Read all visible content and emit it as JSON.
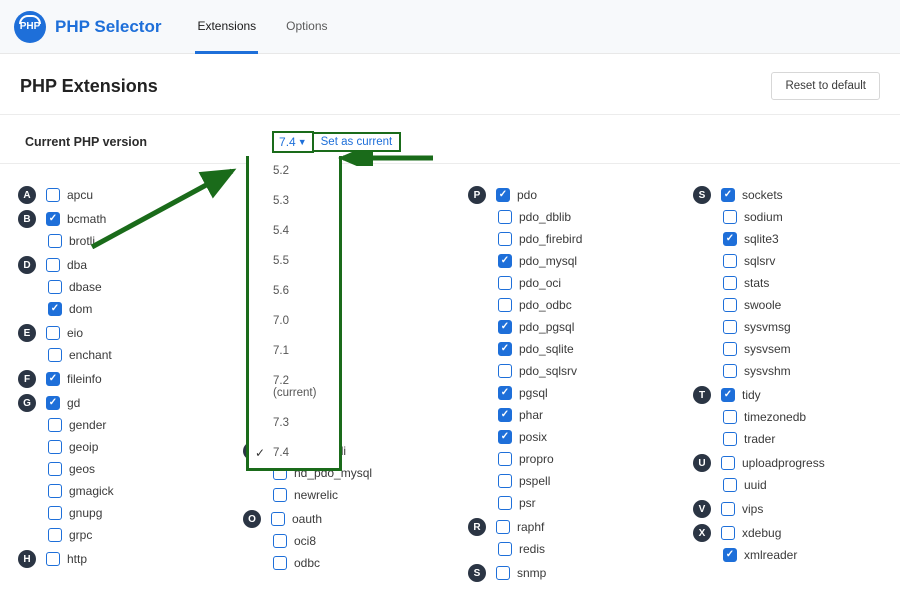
{
  "header": {
    "logo_text": "PHP",
    "app_title": "PHP Selector",
    "tabs": [
      {
        "label": "Extensions",
        "active": true
      },
      {
        "label": "Options",
        "active": false
      }
    ]
  },
  "titlebar": {
    "page_title": "PHP Extensions",
    "reset_label": "Reset to default"
  },
  "version": {
    "label": "Current PHP version",
    "selected": "7.4",
    "set_current_label": "Set as current",
    "options": [
      {
        "label": "5.2"
      },
      {
        "label": "5.3"
      },
      {
        "label": "5.4"
      },
      {
        "label": "5.5"
      },
      {
        "label": "5.6"
      },
      {
        "label": "7.0"
      },
      {
        "label": "7.1"
      },
      {
        "label": "7.2 (current)"
      },
      {
        "label": "7.3"
      },
      {
        "label": "7.4",
        "checked": true
      }
    ]
  },
  "ext": {
    "col1": [
      {
        "letter": "A",
        "items": [
          {
            "name": "apcu",
            "checked": false
          }
        ]
      },
      {
        "letter": "B",
        "items": [
          {
            "name": "bcmath",
            "checked": true
          },
          {
            "name": "brotli",
            "checked": false
          }
        ]
      },
      {
        "letter": "D",
        "items": [
          {
            "name": "dba",
            "checked": false
          },
          {
            "name": "dbase",
            "checked": false
          },
          {
            "name": "dom",
            "checked": true
          }
        ]
      },
      {
        "letter": "E",
        "items": [
          {
            "name": "eio",
            "checked": false
          },
          {
            "name": "enchant",
            "checked": false
          }
        ]
      },
      {
        "letter": "F",
        "items": [
          {
            "name": "fileinfo",
            "checked": true
          }
        ]
      },
      {
        "letter": "G",
        "items": [
          {
            "name": "gd",
            "checked": true
          },
          {
            "name": "gender",
            "checked": false
          },
          {
            "name": "geoip",
            "checked": false
          },
          {
            "name": "geos",
            "checked": false
          },
          {
            "name": "gmagick",
            "checked": false
          },
          {
            "name": "gnupg",
            "checked": false
          },
          {
            "name": "grpc",
            "checked": false
          }
        ]
      },
      {
        "letter": "H",
        "items": [
          {
            "name": "http",
            "checked": false
          }
        ]
      }
    ],
    "col2": [
      {
        "letter": "N",
        "items": [
          {
            "name": "nd_mysqli",
            "checked": true
          },
          {
            "name": "nd_pdo_mysql",
            "checked": false
          },
          {
            "name": "newrelic",
            "checked": false
          }
        ]
      },
      {
        "letter": "O",
        "items": [
          {
            "name": "oauth",
            "checked": false
          },
          {
            "name": "oci8",
            "checked": false
          },
          {
            "name": "odbc",
            "checked": false
          }
        ]
      }
    ],
    "col3": [
      {
        "letter": "P",
        "items": [
          {
            "name": "pdo",
            "checked": true
          },
          {
            "name": "pdo_dblib",
            "checked": false
          },
          {
            "name": "pdo_firebird",
            "checked": false
          },
          {
            "name": "pdo_mysql",
            "checked": true
          },
          {
            "name": "pdo_oci",
            "checked": false
          },
          {
            "name": "pdo_odbc",
            "checked": false
          },
          {
            "name": "pdo_pgsql",
            "checked": true
          },
          {
            "name": "pdo_sqlite",
            "checked": true
          },
          {
            "name": "pdo_sqlsrv",
            "checked": false
          },
          {
            "name": "pgsql",
            "checked": true
          },
          {
            "name": "phar",
            "checked": true
          },
          {
            "name": "posix",
            "checked": true
          },
          {
            "name": "propro",
            "checked": false
          },
          {
            "name": "pspell",
            "checked": false
          },
          {
            "name": "psr",
            "checked": false
          }
        ]
      },
      {
        "letter": "R",
        "items": [
          {
            "name": "raphf",
            "checked": false
          },
          {
            "name": "redis",
            "checked": false
          }
        ]
      },
      {
        "letter": "S",
        "items": [
          {
            "name": "snmp",
            "checked": false
          }
        ]
      }
    ],
    "col4": [
      {
        "letter": "S",
        "items": [
          {
            "name": "sockets",
            "checked": true
          },
          {
            "name": "sodium",
            "checked": false
          },
          {
            "name": "sqlite3",
            "checked": true
          },
          {
            "name": "sqlsrv",
            "checked": false
          },
          {
            "name": "stats",
            "checked": false
          },
          {
            "name": "swoole",
            "checked": false
          },
          {
            "name": "sysvmsg",
            "checked": false
          },
          {
            "name": "sysvsem",
            "checked": false
          },
          {
            "name": "sysvshm",
            "checked": false
          }
        ]
      },
      {
        "letter": "T",
        "items": [
          {
            "name": "tidy",
            "checked": true
          },
          {
            "name": "timezonedb",
            "checked": false
          },
          {
            "name": "trader",
            "checked": false
          }
        ]
      },
      {
        "letter": "U",
        "items": [
          {
            "name": "uploadprogress",
            "checked": false
          },
          {
            "name": "uuid",
            "checked": false
          }
        ]
      },
      {
        "letter": "V",
        "items": [
          {
            "name": "vips",
            "checked": false
          }
        ]
      },
      {
        "letter": "X",
        "items": [
          {
            "name": "xdebug",
            "checked": false
          },
          {
            "name": "xmlreader",
            "checked": true
          }
        ]
      }
    ]
  }
}
